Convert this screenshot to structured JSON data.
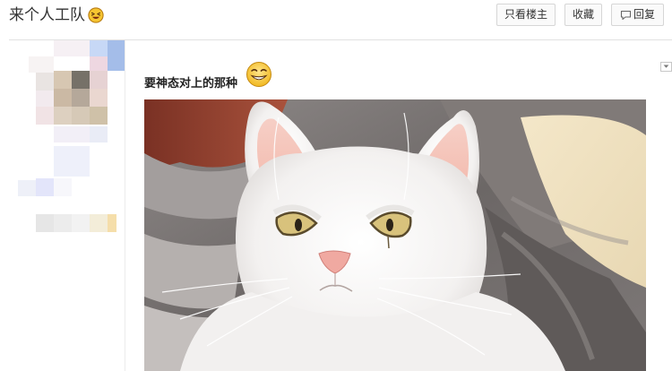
{
  "thread": {
    "title": "来个人工队",
    "title_emoji": "laughing-face-emoji"
  },
  "toolbar": {
    "only_op_label": "只看楼主",
    "favorite_label": "收藏",
    "reply_label": "回复",
    "reply_icon": "speech-bubble-icon"
  },
  "author": {
    "avatar": "pixelated-avatar",
    "name_blurred": true
  },
  "post": {
    "text": "要神态对上的那种",
    "emoji": "grinning-face-emoji",
    "menu_icon": "chevron-down-icon",
    "image": "white-cat-photo"
  },
  "colors": {
    "accent": "#3a6fd8",
    "button_border": "#d6d6d6",
    "divider": "#e1e1e1"
  }
}
